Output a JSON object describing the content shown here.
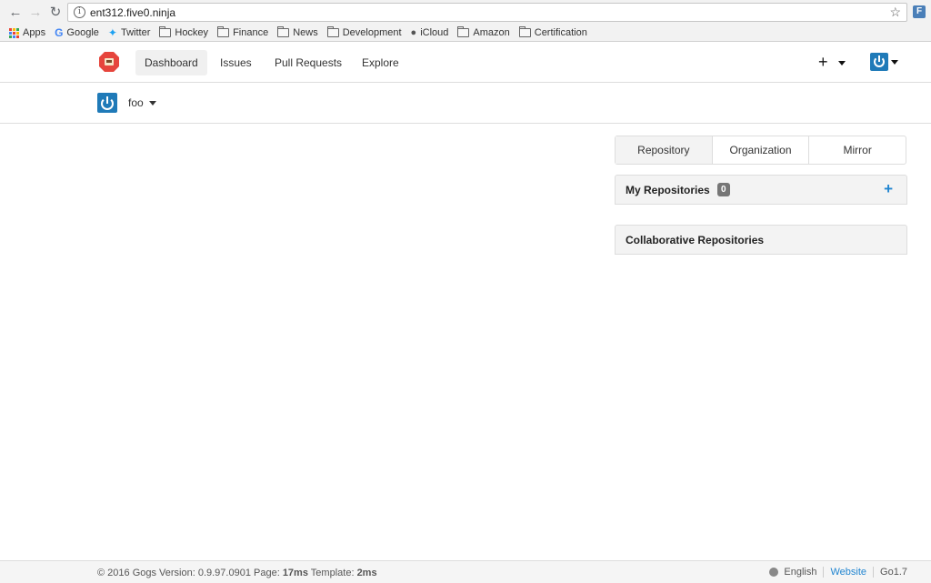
{
  "browser": {
    "url": "ent312.five0.ninja",
    "bookmarks": [
      {
        "label": "Apps",
        "icon": "apps-icon"
      },
      {
        "label": "Google",
        "icon": "google-icon"
      },
      {
        "label": "Twitter",
        "icon": "twitter-icon"
      },
      {
        "label": "Hockey",
        "icon": "folder-icon"
      },
      {
        "label": "Finance",
        "icon": "folder-icon"
      },
      {
        "label": "News",
        "icon": "folder-icon"
      },
      {
        "label": "Development",
        "icon": "folder-icon"
      },
      {
        "label": "iCloud",
        "icon": "apple-icon"
      },
      {
        "label": "Amazon",
        "icon": "folder-icon"
      },
      {
        "label": "Certification",
        "icon": "folder-icon"
      }
    ]
  },
  "header": {
    "nav": [
      "Dashboard",
      "Issues",
      "Pull Requests",
      "Explore"
    ],
    "active": "Dashboard",
    "plus_label": "+"
  },
  "context": {
    "user": "foo"
  },
  "main": {
    "tabs": [
      "Repository",
      "Organization",
      "Mirror"
    ],
    "my_repos": {
      "title": "My Repositories",
      "count": "0",
      "add": "+"
    },
    "collab_repos": {
      "title": "Collaborative Repositories"
    }
  },
  "footer": {
    "copyright": "© 2016 Gogs Version: 0.9.97.0901 Page: ",
    "page_time": "17ms",
    "template_label": " Template: ",
    "template_time": "2ms",
    "language": "English",
    "website": "Website",
    "go_version": "Go1.7"
  },
  "colors": {
    "accent": "#2185d0",
    "avatar": "#1f7ab8",
    "badge": "#767676",
    "logo": "#e6453c"
  }
}
